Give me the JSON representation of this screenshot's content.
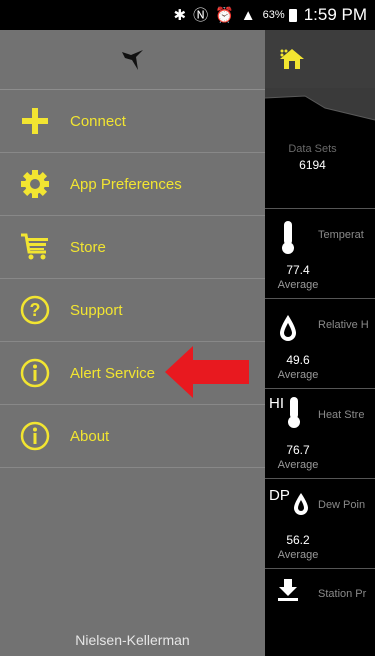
{
  "status_bar": {
    "battery_pct": "63%",
    "time": "1:59 PM"
  },
  "drawer": {
    "items": [
      {
        "label": "Connect",
        "icon": "plus-icon"
      },
      {
        "label": "App Preferences",
        "icon": "gear-icon"
      },
      {
        "label": "Store",
        "icon": "cart-icon"
      },
      {
        "label": "Support",
        "icon": "question-icon"
      },
      {
        "label": "Alert Service",
        "icon": "info-icon"
      },
      {
        "label": "About",
        "icon": "info-icon"
      }
    ],
    "footer": "Nielsen-Kellerman"
  },
  "app": {
    "datasets_label": "Data Sets",
    "datasets_value": "6194",
    "rows": [
      {
        "title": "Temperat",
        "value": "77.4",
        "avg_label": "Average",
        "icon": "thermometer-icon"
      },
      {
        "title": "Relative H",
        "value": "49.6",
        "avg_label": "Average",
        "icon": "drop-icon"
      },
      {
        "title": "Heat Stre",
        "value": "76.7",
        "avg_label": "Average",
        "icon": "heat-index-icon",
        "icon_text": "HI"
      },
      {
        "title": "Dew Poin",
        "value": "56.2",
        "avg_label": "Average",
        "icon": "dew-point-icon",
        "icon_text": "DP"
      },
      {
        "title": "Station Pr",
        "icon": "download-icon"
      }
    ]
  },
  "colors": {
    "accent": "#f2e531",
    "drawer_bg": "#727272",
    "arrow": "#e8191f"
  }
}
